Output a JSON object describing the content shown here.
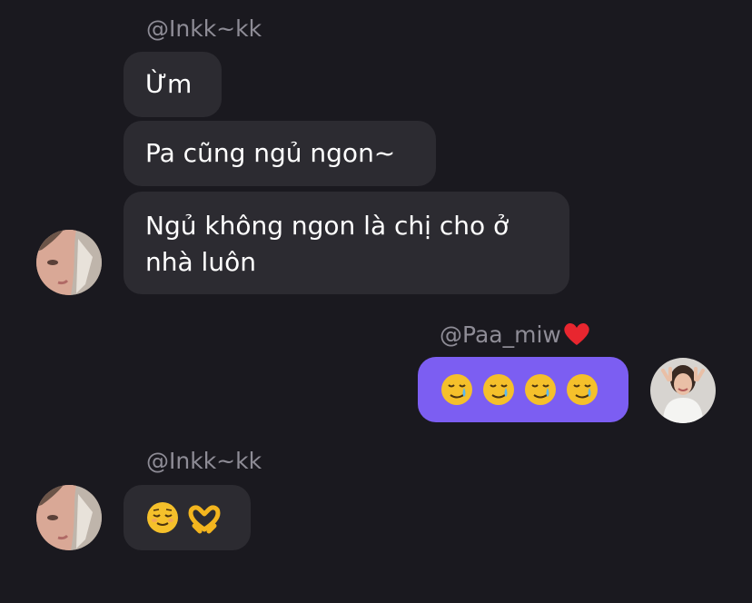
{
  "colors": {
    "background": "#1a191f",
    "incoming_bubble": "#2c2b31",
    "outgoing_bubble": "#7c5ef2",
    "username": "#8e8c96",
    "text": "#ffffff"
  },
  "messages": [
    {
      "group": "incoming",
      "sender": "@Inkk~kk",
      "avatar": "avatar-girl-1",
      "bubbles": [
        "Ừm",
        "Pa cũng ngủ ngon~",
        "Ngủ không ngon là chị cho ở\nnhà luôn"
      ]
    },
    {
      "group": "outgoing",
      "sender": "@Paa_miw",
      "sender_suffix_icon": "red-heart-icon",
      "avatar": "avatar-girl-2",
      "bubbles": [
        {
          "emoji": [
            "smiling-face-with-tear-icon",
            "smiling-face-with-tear-icon",
            "smiling-face-with-tear-icon",
            "smiling-face-with-tear-icon"
          ]
        }
      ]
    },
    {
      "group": "incoming",
      "sender": "@Inkk~kk",
      "avatar": "avatar-girl-1",
      "bubbles": [
        {
          "emoji": [
            "relieved-face-icon",
            "heart-hands-icon"
          ]
        }
      ]
    }
  ],
  "chat": {
    "sender1_name": "@Inkk~kk",
    "msg1": "Ừm",
    "msg2": "Pa cũng ngủ ngon~",
    "msg3_line1": "Ngủ không ngon là chị cho ở",
    "msg3_line2": "nhà luôn",
    "sender2_name": "@Paa_miw",
    "sender3_name": "@Inkk~kk"
  }
}
